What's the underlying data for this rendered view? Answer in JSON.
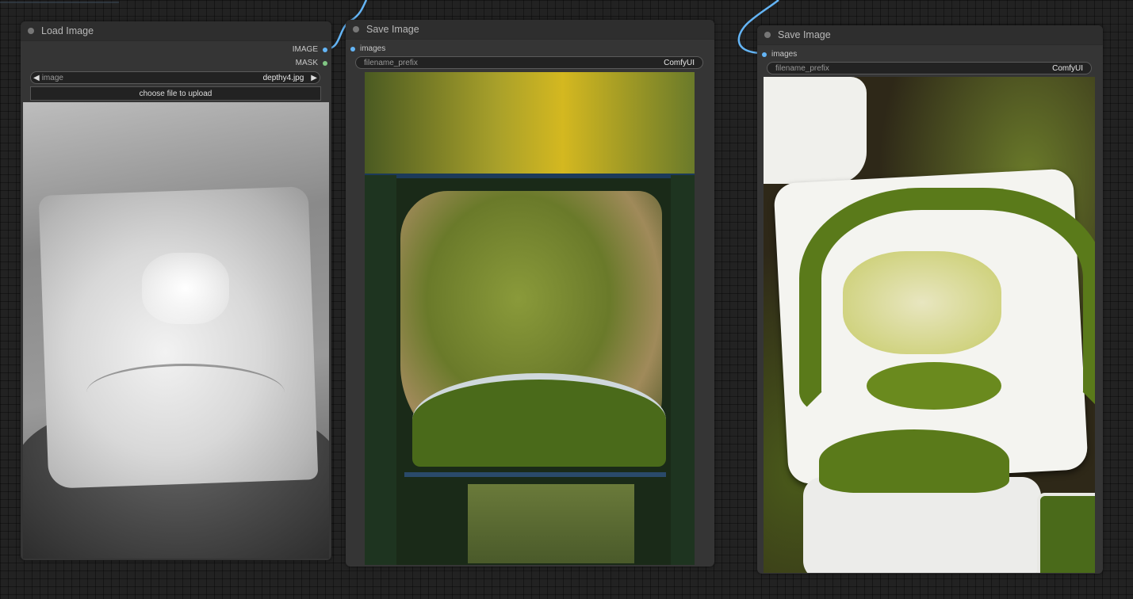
{
  "colors": {
    "canvas": "#222222",
    "node_body": "#353535",
    "node_title": "#2e2e2e",
    "image_link": "#64b5f6",
    "mask_link": "#81c784"
  },
  "load_node": {
    "title": "Load Image",
    "outputs": [
      {
        "label": "IMAGE",
        "color": "#64b5f6"
      },
      {
        "label": "MASK",
        "color": "#81c784"
      }
    ],
    "image_widget": {
      "label": "image",
      "value": "depthy4.jpg",
      "prev_icon": "◀",
      "next_icon": "▶"
    },
    "upload_label": "choose file to upload",
    "preview_icon": "grayscale-depth-photo"
  },
  "save_node_1": {
    "title": "Save Image",
    "input_label": "images",
    "filename_prefix": {
      "label": "filename_prefix",
      "value": "ComfyUI"
    },
    "preview_icon": "aerial-forest-photo"
  },
  "save_node_2": {
    "title": "Save Image",
    "input_label": "images",
    "filename_prefix": {
      "label": "filename_prefix",
      "value": "ComfyUI"
    },
    "preview_icon": "moss-plates-photo"
  }
}
